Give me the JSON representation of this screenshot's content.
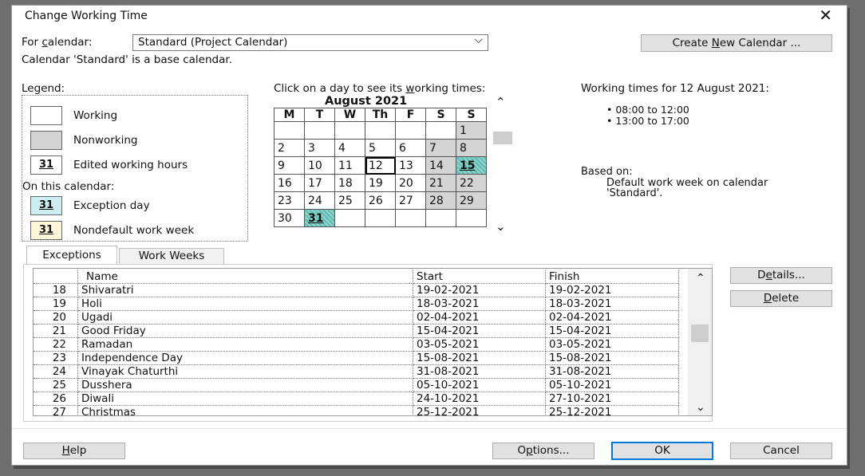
{
  "dialog": {
    "title": "Change Working Time",
    "close_glyph": "✕"
  },
  "calendar_select": {
    "label_pre": "For ",
    "label_key": "c",
    "label_post": "alendar:",
    "value": "Standard (Project Calendar)",
    "info": "Calendar 'Standard' is a base calendar."
  },
  "create_button": {
    "pre": "Create ",
    "key": "N",
    "post": "ew Calendar ..."
  },
  "legend": {
    "title": "Legend:",
    "items": [
      {
        "label": "Working"
      },
      {
        "label": "Nonworking"
      },
      {
        "label": "Edited working hours",
        "num": "31"
      }
    ],
    "on_calendar": "On this calendar:",
    "calendar_items": [
      {
        "label": "Exception day",
        "num": "31"
      },
      {
        "label": "Nondefault work week",
        "num": "31"
      }
    ]
  },
  "month_view": {
    "prompt_pre": "Click on a day to see its ",
    "prompt_key": "w",
    "prompt_post": "orking times:",
    "month_title": "August 2021",
    "weekdays": [
      "M",
      "T",
      "W",
      "Th",
      "F",
      "S",
      "S"
    ],
    "weeks": [
      [
        "",
        "",
        "",
        "",
        "",
        "",
        "1"
      ],
      [
        "2",
        "3",
        "4",
        "5",
        "6",
        "7",
        "8"
      ],
      [
        "9",
        "10",
        "11",
        "12",
        "13",
        "14",
        "15"
      ],
      [
        "16",
        "17",
        "18",
        "19",
        "20",
        "21",
        "22"
      ],
      [
        "23",
        "24",
        "25",
        "26",
        "27",
        "28",
        "29"
      ],
      [
        "30",
        "31",
        "",
        "",
        "",
        "",
        ""
      ]
    ],
    "scroll_up": "⌃",
    "scroll_down": "⌄"
  },
  "working_times": {
    "title": "Working times for 12 August 2021:",
    "times": [
      "• 08:00 to 12:00",
      "• 13:00 to 17:00"
    ],
    "based_on_label": "Based on:",
    "based_on_text_1": "Default work week on calendar",
    "based_on_text_2": "'Standard'."
  },
  "tabs": [
    {
      "label": "Exceptions"
    },
    {
      "label": "Work Weeks"
    }
  ],
  "exceptions_table": {
    "headers": [
      "",
      "Name",
      "Start",
      "Finish"
    ],
    "rows": [
      {
        "id": "18",
        "name": "Shivaratri",
        "start": "19-02-2021",
        "finish": "19-02-2021"
      },
      {
        "id": "19",
        "name": "Holi",
        "start": "18-03-2021",
        "finish": "18-03-2021"
      },
      {
        "id": "20",
        "name": "Ugadi",
        "start": "02-04-2021",
        "finish": "02-04-2021"
      },
      {
        "id": "21",
        "name": "Good Friday",
        "start": "15-04-2021",
        "finish": "15-04-2021"
      },
      {
        "id": "22",
        "name": "Ramadan",
        "start": "03-05-2021",
        "finish": "03-05-2021"
      },
      {
        "id": "23",
        "name": "Independence Day",
        "start": "15-08-2021",
        "finish": "15-08-2021"
      },
      {
        "id": "24",
        "name": "Vinayak Chaturthi",
        "start": "31-08-2021",
        "finish": "31-08-2021"
      },
      {
        "id": "25",
        "name": "Dusshera",
        "start": "05-10-2021",
        "finish": "05-10-2021"
      },
      {
        "id": "26",
        "name": "Diwali",
        "start": "24-10-2021",
        "finish": "27-10-2021"
      },
      {
        "id": "27",
        "name": "Christmas",
        "start": "25-12-2021",
        "finish": "25-12-2021"
      }
    ]
  },
  "side_buttons": {
    "details": {
      "pre": "D",
      "key": "e",
      "post": "tails..."
    },
    "delete": {
      "pre": "",
      "key": "D",
      "post": "elete"
    }
  },
  "footer": {
    "help": {
      "pre": "",
      "key": "H",
      "post": "elp"
    },
    "options": {
      "pre": "O",
      "key": "p",
      "post": "tions..."
    },
    "ok": "OK",
    "cancel": "Cancel"
  }
}
